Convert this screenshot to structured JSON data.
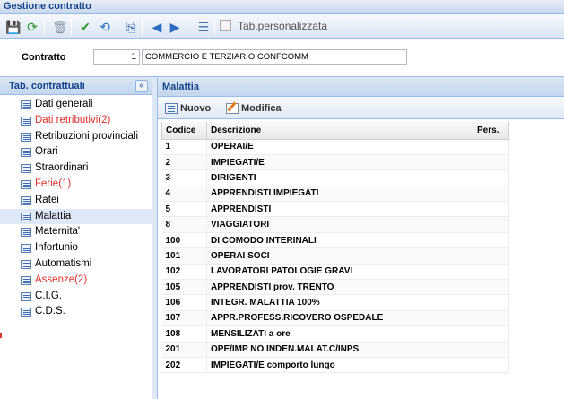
{
  "window": {
    "title": "Gestione contratto"
  },
  "toolbar": {
    "buttons": [
      {
        "name": "save-icon",
        "glyph": "💾",
        "color": "#1f5fb8"
      },
      {
        "name": "refresh-icon",
        "glyph": "⟳",
        "color": "#2e9a2e"
      },
      {
        "name": "delete-icon",
        "glyph": "🗑",
        "color": "#8899aa"
      },
      {
        "name": "confirm-icon",
        "glyph": "✔",
        "color": "#2e9a2e"
      },
      {
        "name": "cancel-icon",
        "glyph": "⟲",
        "color": "#1f6fc4"
      },
      {
        "name": "copy-icon",
        "glyph": "⎘",
        "color": "#2d5fa8"
      },
      {
        "name": "prev-icon",
        "glyph": "◀",
        "color": "#2d6cc0"
      },
      {
        "name": "next-icon",
        "glyph": "▶",
        "color": "#2d6cc0"
      },
      {
        "name": "list-icon",
        "glyph": "☰",
        "color": "#4a6fa5"
      }
    ],
    "checkbox_label": "Tab.personalizzata"
  },
  "contract": {
    "label": "Contratto",
    "number": "1",
    "description": "COMMERCIO E TERZIARIO CONFCOMM"
  },
  "left_panel": {
    "title": "Tab. contrattuali",
    "collapse_glyph": "«",
    "items": [
      {
        "label": "Dati generali",
        "red": false,
        "selected": false
      },
      {
        "label": "Dati retributivi(2)",
        "red": true,
        "selected": false
      },
      {
        "label": "Retribuzioni provinciali",
        "red": false,
        "selected": false
      },
      {
        "label": "Orari",
        "red": false,
        "selected": false
      },
      {
        "label": "Straordinari",
        "red": false,
        "selected": false
      },
      {
        "label": "Ferie(1)",
        "red": true,
        "selected": false
      },
      {
        "label": "Ratei",
        "red": false,
        "selected": false
      },
      {
        "label": "Malattia",
        "red": false,
        "selected": true
      },
      {
        "label": "Maternita'",
        "red": false,
        "selected": false
      },
      {
        "label": "Infortunio",
        "red": false,
        "selected": false
      },
      {
        "label": "Automatismi",
        "red": false,
        "selected": false
      },
      {
        "label": "Assenze(2)",
        "red": true,
        "selected": false
      },
      {
        "label": "C.I.G.",
        "red": false,
        "selected": false
      },
      {
        "label": "C.D.S.",
        "red": false,
        "selected": false
      }
    ]
  },
  "right_panel": {
    "title": "Malattia",
    "new_label": "Nuovo",
    "edit_label": "Modifica",
    "columns": [
      "Codice",
      "Descrizione",
      "Pers."
    ],
    "rows": [
      [
        "1",
        "OPERAI/E",
        ""
      ],
      [
        "2",
        "IMPIEGATI/E",
        ""
      ],
      [
        "3",
        "DIRIGENTI",
        ""
      ],
      [
        "4",
        "APPRENDISTI IMPIEGATI",
        ""
      ],
      [
        "5",
        "APPRENDISTI",
        ""
      ],
      [
        "8",
        "VIAGGIATORI",
        ""
      ],
      [
        "100",
        "DI COMODO INTERINALI",
        ""
      ],
      [
        "101",
        "OPERAI SOCI",
        ""
      ],
      [
        "102",
        "LAVORATORI PATOLOGIE GRAVI",
        ""
      ],
      [
        "105",
        "APPRENDISTI prov. TRENTO",
        ""
      ],
      [
        "106",
        "INTEGR. MALATTIA 100%",
        ""
      ],
      [
        "107",
        "APPR.PROFESS.RICOVERO OSPEDALE",
        ""
      ],
      [
        "108",
        "MENSILIZATI a ore",
        ""
      ],
      [
        "201",
        "OPE/IMP NO INDEN.MALAT.C/INPS",
        ""
      ],
      [
        "202",
        "IMPIEGATI/E comporto lungo",
        ""
      ]
    ]
  },
  "colors": {
    "accent": "#15428b",
    "border": "#99bbe8",
    "warning_text": "#e0302a",
    "selected_row": "#dfe8f6"
  }
}
